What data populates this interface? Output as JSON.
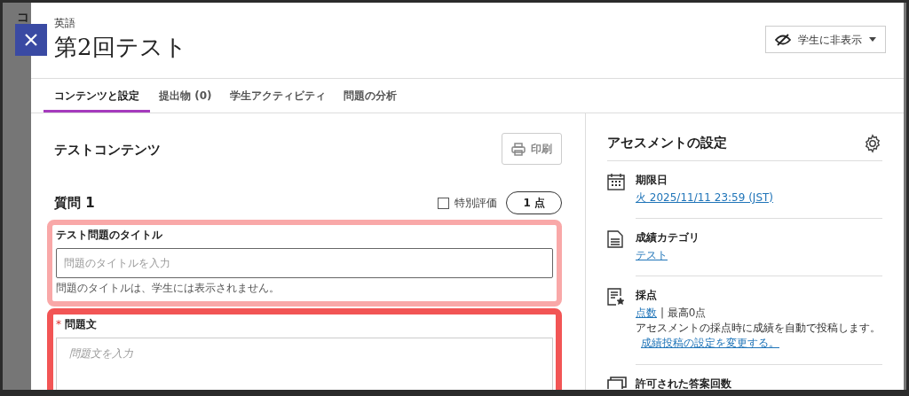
{
  "backdrop_text": "コ",
  "header": {
    "subject": "英語",
    "title": "第2回テスト",
    "visibility": {
      "label": "学生に非表示",
      "visible": false
    }
  },
  "tabs": [
    {
      "label": "コンテンツと設定",
      "selected": true
    },
    {
      "label": "提出物 (0)",
      "selected": false
    },
    {
      "label": "学生アクティビティ",
      "selected": false
    },
    {
      "label": "問題の分析",
      "selected": false
    }
  ],
  "content": {
    "heading": "テストコンテンツ",
    "print_button": "印刷",
    "question": {
      "title": "質問 1",
      "extra_credit": {
        "label": "特別評価",
        "checked": false
      },
      "points": "1 点",
      "fields": [
        {
          "kind": "input",
          "label": "テスト問題のタイトル",
          "required": false,
          "placeholder": "問題のタイトルを入力",
          "help": "問題のタイトルは、学生には表示されません。",
          "color": "#f9a8a8"
        },
        {
          "kind": "textarea",
          "label": "問題文",
          "required": true,
          "required_mark": "*",
          "placeholder": "問題文を入力",
          "color": "#f25555"
        }
      ]
    }
  },
  "settings": {
    "heading": "アセスメントの設定",
    "items": [
      {
        "kind": "calendar",
        "title": "期限日",
        "link": "火 2025/11/11 23:59 (JST)"
      },
      {
        "kind": "document",
        "title": "成績カテゴリ",
        "link": "テスト"
      },
      {
        "kind": "grading",
        "title": "採点",
        "link": "点数",
        "text": "| 最高0点",
        "note": "アセスメントの採点時に成績を自動で投稿します。",
        "note_link": "成績投稿の設定を変更する。"
      },
      {
        "kind": "attempts",
        "title": "許可された答案回数"
      }
    ]
  }
}
